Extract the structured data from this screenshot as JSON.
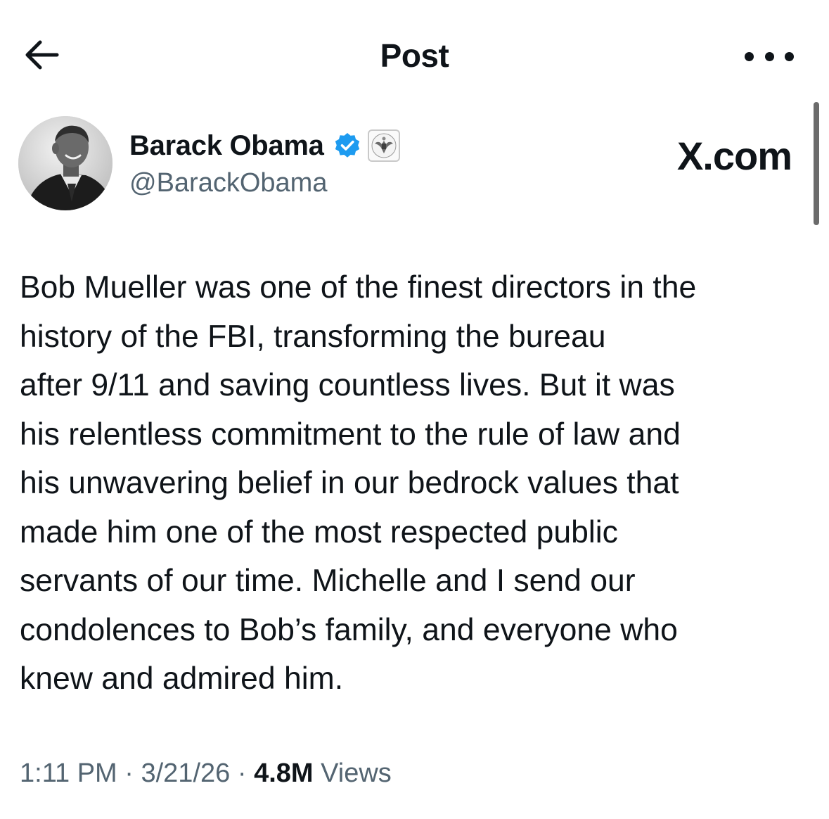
{
  "header": {
    "title": "Post",
    "back_icon": "arrow-left-icon",
    "more_icon": "more-horizontal-icon"
  },
  "author": {
    "display_name": "Barack Obama",
    "handle": "@BarackObama",
    "verified": true,
    "verified_color": "#1d9bf0",
    "affiliation_badge": "us-government-seal-icon"
  },
  "watermark": "X.com",
  "tweet": {
    "lines": [
      "Bob Mueller was one of the finest directors in the",
      "history of the FBI, transforming the bureau",
      "after 9/11 and saving countless lives. But it was",
      "his relentless commitment to the rule of law and",
      "his unwavering belief in our bedrock values that",
      "made him one of the most respected public",
      "servants of our time. Michelle and I send our",
      "condolences to Bob’s family, and everyone who",
      "knew and admired him."
    ]
  },
  "meta": {
    "time": "1:11 PM",
    "separator": "·",
    "date": "3/21/26",
    "views_count": "4.8M",
    "views_label": "Views"
  }
}
